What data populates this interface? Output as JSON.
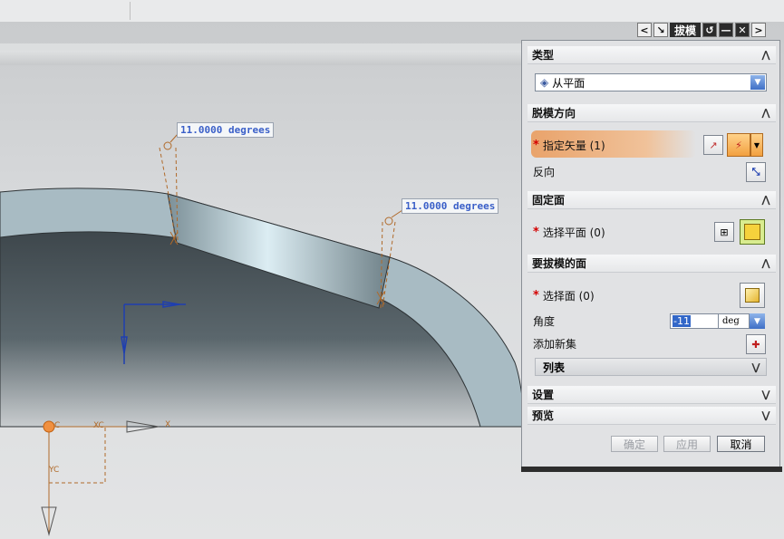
{
  "window": {
    "title": "拔模",
    "controls": [
      "<",
      "↘",
      "↺",
      "—",
      "✕",
      ">"
    ]
  },
  "viewport": {
    "dimension_labels": [
      "11.0000 degrees",
      "11.0000 degrees"
    ],
    "axis_labels": {
      "xc": "XC",
      "yc": "YC",
      "c": "C",
      "x": "X"
    }
  },
  "dialog": {
    "sections": {
      "type": {
        "title": "类型",
        "value": "从平面"
      },
      "draft_direction": {
        "title": "脱模方向",
        "specify_vector": "指定矢量 (1)",
        "reverse": "反向"
      },
      "fixed_face": {
        "title": "固定面",
        "select_plane": "选择平面 (0)"
      },
      "faces": {
        "title": "要拔模的面",
        "select_face": "选择面 (0)",
        "angle_label": "角度",
        "angle_value": "-11",
        "angle_unit": "deg",
        "add_set": "添加新集",
        "list": "列表"
      },
      "settings": {
        "title": "设置"
      },
      "preview": {
        "title": "预览"
      }
    },
    "buttons": {
      "ok": "确定",
      "apply": "应用",
      "cancel": "取消"
    }
  }
}
